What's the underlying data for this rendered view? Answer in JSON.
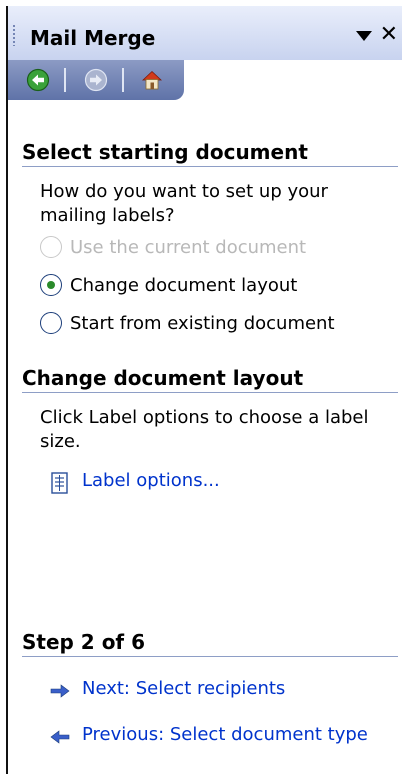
{
  "pane": {
    "title": "Mail Merge",
    "nav": {
      "back_icon": "back-arrow-icon",
      "forward_icon": "forward-arrow-icon",
      "home_icon": "home-icon"
    }
  },
  "section1": {
    "heading": "Select starting document",
    "question": "How do you want to set up your mailing labels?",
    "options": [
      {
        "label": "Use the current document",
        "state": "disabled"
      },
      {
        "label": "Change document layout",
        "state": "checked"
      },
      {
        "label": "Start from existing document",
        "state": "unchecked"
      }
    ]
  },
  "section2": {
    "heading": "Change document layout",
    "text": "Click Label options to choose a label size.",
    "link": "Label options..."
  },
  "step": {
    "heading": "Step 2 of 6",
    "next": "Next: Select recipients",
    "previous": "Previous: Select document type"
  },
  "colors": {
    "link": "#0033cc",
    "accent": "#5f73a8"
  }
}
